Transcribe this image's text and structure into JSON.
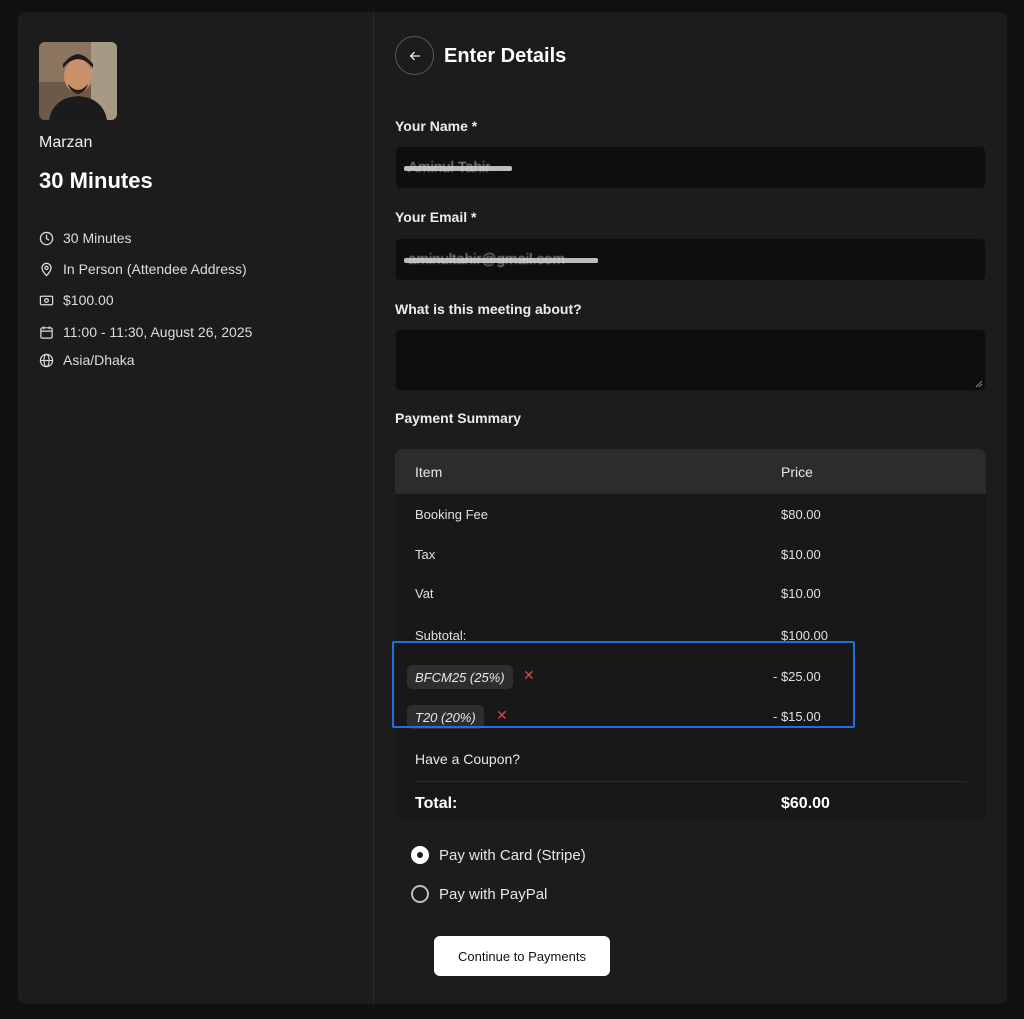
{
  "host": {
    "name": "Marzan",
    "avatar_icon": "person-photo"
  },
  "event": {
    "title": "30 Minutes",
    "duration": "30 Minutes",
    "location": "In Person (Attendee Address)",
    "price": "$100.00",
    "datetime": "11:00 - 11:30, August 26, 2025",
    "timezone": "Asia/Dhaka"
  },
  "form": {
    "page_title": "Enter Details",
    "name_label": "Your Name *",
    "name_value": "Aminul Tahir",
    "email_label": "Your Email *",
    "email_value": "aminultahir@gmail.com",
    "about_label": "What is this meeting about?",
    "about_value": ""
  },
  "payment_summary": {
    "title": "Payment Summary",
    "col_item": "Item",
    "col_price": "Price",
    "rows": [
      {
        "item": "Booking Fee",
        "price": "$80.00"
      },
      {
        "item": "Tax",
        "price": "$10.00"
      },
      {
        "item": "Vat",
        "price": "$10.00"
      },
      {
        "item": "Subtotal:",
        "price": "$100.00"
      }
    ],
    "coupons": [
      {
        "code": "BFCM25 (25%)",
        "discount": "- $25.00"
      },
      {
        "code": "T20 (20%)",
        "discount": "- $15.00"
      }
    ],
    "coupon_prompt": "Have a Coupon?",
    "total_label": "Total:",
    "total_value": "$60.00"
  },
  "payment_methods": [
    {
      "label": "Pay with Card (Stripe)",
      "selected": true
    },
    {
      "label": "Pay with PayPal",
      "selected": false
    }
  ],
  "continue_label": "Continue to Payments",
  "colors": {
    "background": "#1c1c1c",
    "highlight": "#1f6fe0",
    "remove_x": "#e2404a"
  }
}
